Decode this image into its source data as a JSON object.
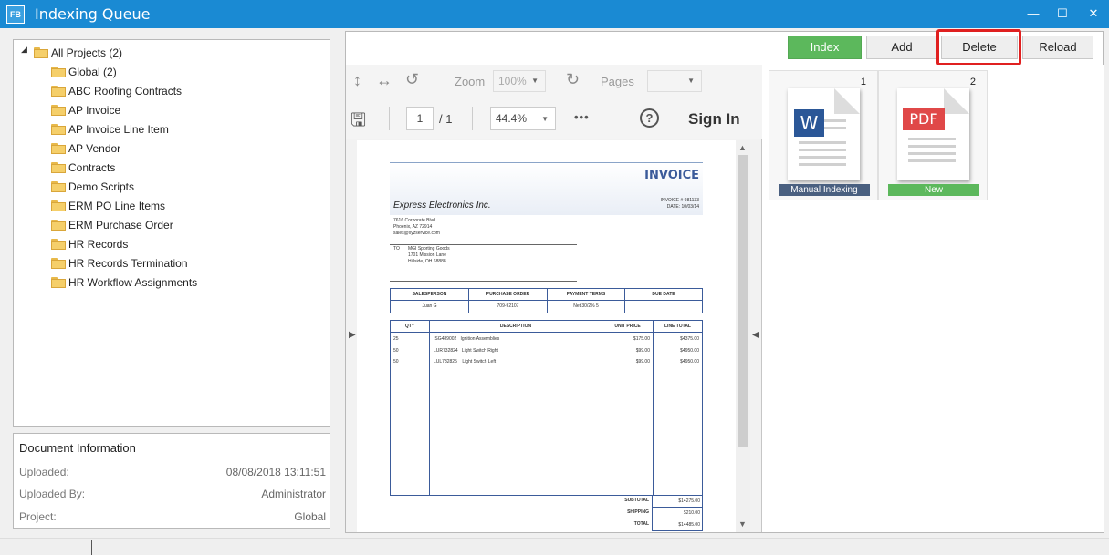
{
  "window": {
    "icon_text": "FB",
    "title": "Indexing Queue",
    "minimize": "—",
    "maximize": "☐",
    "close": "✕"
  },
  "tree": {
    "root": "All Projects (2)",
    "items": [
      "Global (2)",
      "ABC Roofing Contracts",
      "AP Invoice",
      "AP Invoice Line Item",
      "AP Vendor",
      "Contracts",
      "Demo Scripts",
      "ERM PO Line Items",
      "ERM Purchase Order",
      "HR Records",
      "HR Records Termination",
      "HR Workflow Assignments"
    ]
  },
  "doc_info": {
    "title": "Document Information",
    "uploaded_label": "Uploaded:",
    "uploaded_value": "08/08/2018 13:11:51",
    "uploaded_by_label": "Uploaded By:",
    "uploaded_by_value": "Administrator",
    "project_label": "Project:",
    "project_value": "Global"
  },
  "actions": {
    "index": "Index",
    "add": "Add",
    "delete": "Delete",
    "reload": "Reload"
  },
  "viewer": {
    "zoom_label": "Zoom",
    "zoom_value": "100%",
    "pages_label": "Pages",
    "pages_value": "",
    "page_current": "1",
    "page_total": "/ 1",
    "scale": "44.4%",
    "more": "•••",
    "help": "?",
    "sign_in": "Sign In"
  },
  "invoice": {
    "title": "INVOICE",
    "company": "Express Electronics Inc.",
    "invoice_no": "INVOICE #    981133",
    "date": "DATE:   10/03/14",
    "addr1": "7616 Corporate Blvd",
    "addr2": "Phoenix, AZ 72914",
    "addr3": "sales@xyzservice.com",
    "to_label": "TO",
    "to1": "MGI Sporting Goods",
    "to2": "1701 Mission Lane",
    "to3": "Hillside, OH 68888",
    "meta_headers": [
      "SALESPERSON",
      "PURCHASE ORDER",
      "PAYMENT TERMS",
      "DUE DATE"
    ],
    "meta_values": [
      "Juan G",
      "709-92107",
      "Net 30/2% 5",
      ""
    ],
    "item_headers": [
      "QTY",
      "DESCRIPTION",
      "UNIT PRICE",
      "LINE TOTAL"
    ],
    "items": [
      {
        "qty": "25",
        "desc": "ISG489002   Ignition Assemblies",
        "unit": "$175.00",
        "total": "$4375.00"
      },
      {
        "qty": "50",
        "desc": "LUR732824   Light Switch Right",
        "unit": "$99.00",
        "total": "$4950.00"
      },
      {
        "qty": "50",
        "desc": "LUL732825    Light Switch Left",
        "unit": "$99.00",
        "total": "$4950.00"
      }
    ],
    "subtotal_label": "SUBTOTAL",
    "subtotal": "$14275.00",
    "shipping_label": "SHIPPING",
    "shipping": "$210.00",
    "total_label": "TOTAL",
    "total": "$14485.00"
  },
  "thumbnails": [
    {
      "num": "1",
      "badge": "W",
      "label": "Manual Indexing",
      "label_color": "#4a6080"
    },
    {
      "num": "2",
      "badge": "PDF",
      "label": "New",
      "label_color": "#5cb85c"
    }
  ]
}
